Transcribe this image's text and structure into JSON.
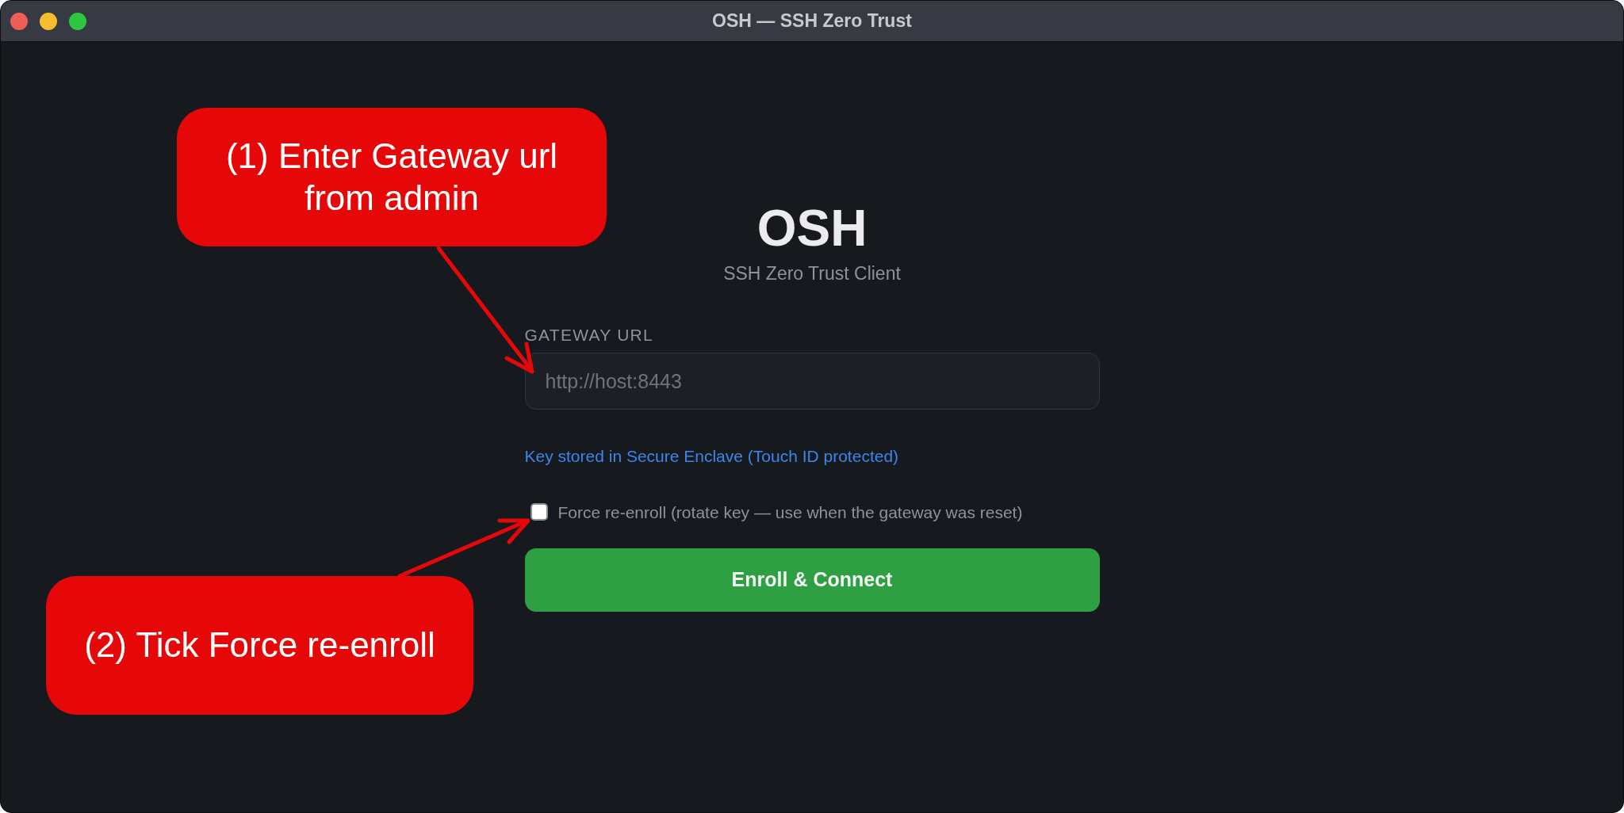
{
  "window": {
    "title": "OSH — SSH Zero Trust"
  },
  "app": {
    "title": "OSH",
    "subtitle": "SSH Zero Trust Client"
  },
  "gateway_url": {
    "label": "GATEWAY URL",
    "placeholder": "http://host:8443"
  },
  "key_notice": "Key stored in Secure Enclave (Touch ID protected)",
  "force_reenroll": {
    "label": "Force re-enroll (rotate key — use when the gateway was reset)",
    "checked": false
  },
  "primary_button": "Enroll & Connect",
  "annotations": [
    {
      "text": "(1) Enter Gateway url from admin"
    },
    {
      "text": "(2) Tick Force re-enroll"
    }
  ]
}
